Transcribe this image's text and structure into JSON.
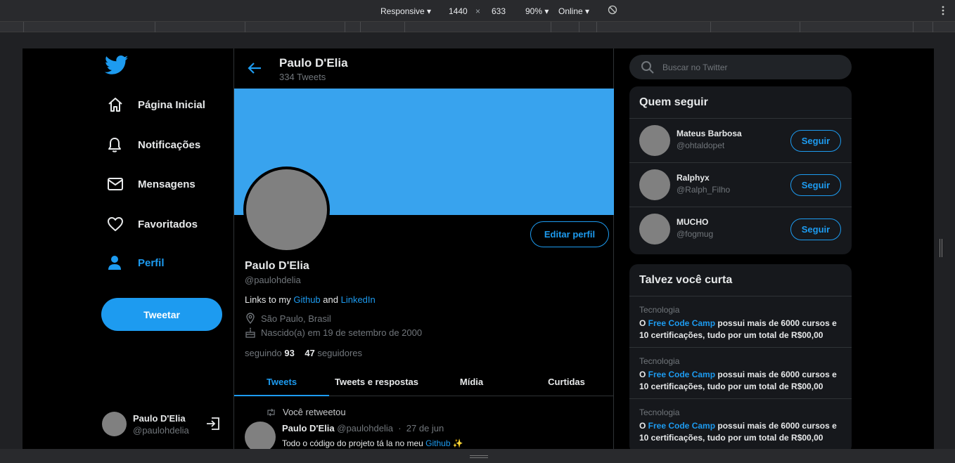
{
  "devtools": {
    "device": "Responsive ▾",
    "width": "1440",
    "times": "×",
    "height": "633",
    "zoom": "90% ▾",
    "network": "Online ▾",
    "rotate_icon": "rotate-icon",
    "menu_icon": "kebab-menu-icon"
  },
  "nav": {
    "logo_icon": "twitter-bird-icon",
    "items": [
      {
        "label": "Página Inicial",
        "icon": "home-icon"
      },
      {
        "label": "Notificações",
        "icon": "bell-icon"
      },
      {
        "label": "Mensagens",
        "icon": "mail-icon"
      },
      {
        "label": "Favoritados",
        "icon": "heart-icon"
      },
      {
        "label": "Perfil",
        "icon": "person-icon",
        "active": true
      }
    ],
    "tweet_button": "Tweetar",
    "me": {
      "name": "Paulo D'Elia",
      "handle": "@paulohdelia",
      "logout_icon": "logout-icon"
    }
  },
  "header": {
    "title": "Paulo D'Elia",
    "subtitle": "334 Tweets"
  },
  "profile": {
    "banner_color": "#38a3ee",
    "edit_button": "Editar perfil",
    "name": "Paulo D'Elia",
    "handle": "@paulohdelia",
    "bio_prefix": "Links to my ",
    "bio_link1": "Github",
    "bio_mid": " and ",
    "bio_link2": "LinkedIn",
    "location": "São Paulo, Brasil",
    "birth": "Nascido(a) em 19 de setembro de 2000",
    "following_label": "seguindo",
    "following_count": "93",
    "followers_count": "47",
    "followers_label": "seguidores"
  },
  "tabs": [
    {
      "label": "Tweets",
      "active": true
    },
    {
      "label": "Tweets e respostas"
    },
    {
      "label": "Mídia"
    },
    {
      "label": "Curtidas"
    }
  ],
  "tweet": {
    "retweet_label": "Você retweetou",
    "name": "Paulo D'Elia",
    "handle": "@paulohdelia",
    "sep": "·",
    "date": "27 de jun",
    "text": "Todo o código do projeto tá la no meu ",
    "text_link": "Github",
    "emoji": "✨"
  },
  "search": {
    "placeholder": "Buscar no Twitter"
  },
  "who_to_follow": {
    "title": "Quem seguir",
    "button": "Seguir",
    "users": [
      {
        "name": "Mateus Barbosa",
        "handle": "@ohtaldopet"
      },
      {
        "name": "Ralphyx",
        "handle": "@Ralph_Filho"
      },
      {
        "name": "MUCHO",
        "handle": "@fogmug"
      }
    ]
  },
  "trends": {
    "title": "Talvez você curta",
    "items": [
      {
        "category": "Tecnologia",
        "pre": "O ",
        "link": "Free Code Camp",
        "post": " possui mais de 6000 cursos e 10 certificações, tudo por um total de R$00,00"
      },
      {
        "category": "Tecnologia",
        "pre": "O ",
        "link": "Free Code Camp",
        "post": " possui mais de 6000 cursos e 10 certificações, tudo por um total de R$00,00"
      },
      {
        "category": "Tecnologia",
        "pre": "O ",
        "link": "Free Code Camp",
        "post": " possui mais de 6000 cursos e 10 certificações, tudo por um total de R$00,00"
      }
    ]
  },
  "colors": {
    "accent": "#1d9bf0",
    "background": "#000000",
    "card": "#16181c"
  }
}
